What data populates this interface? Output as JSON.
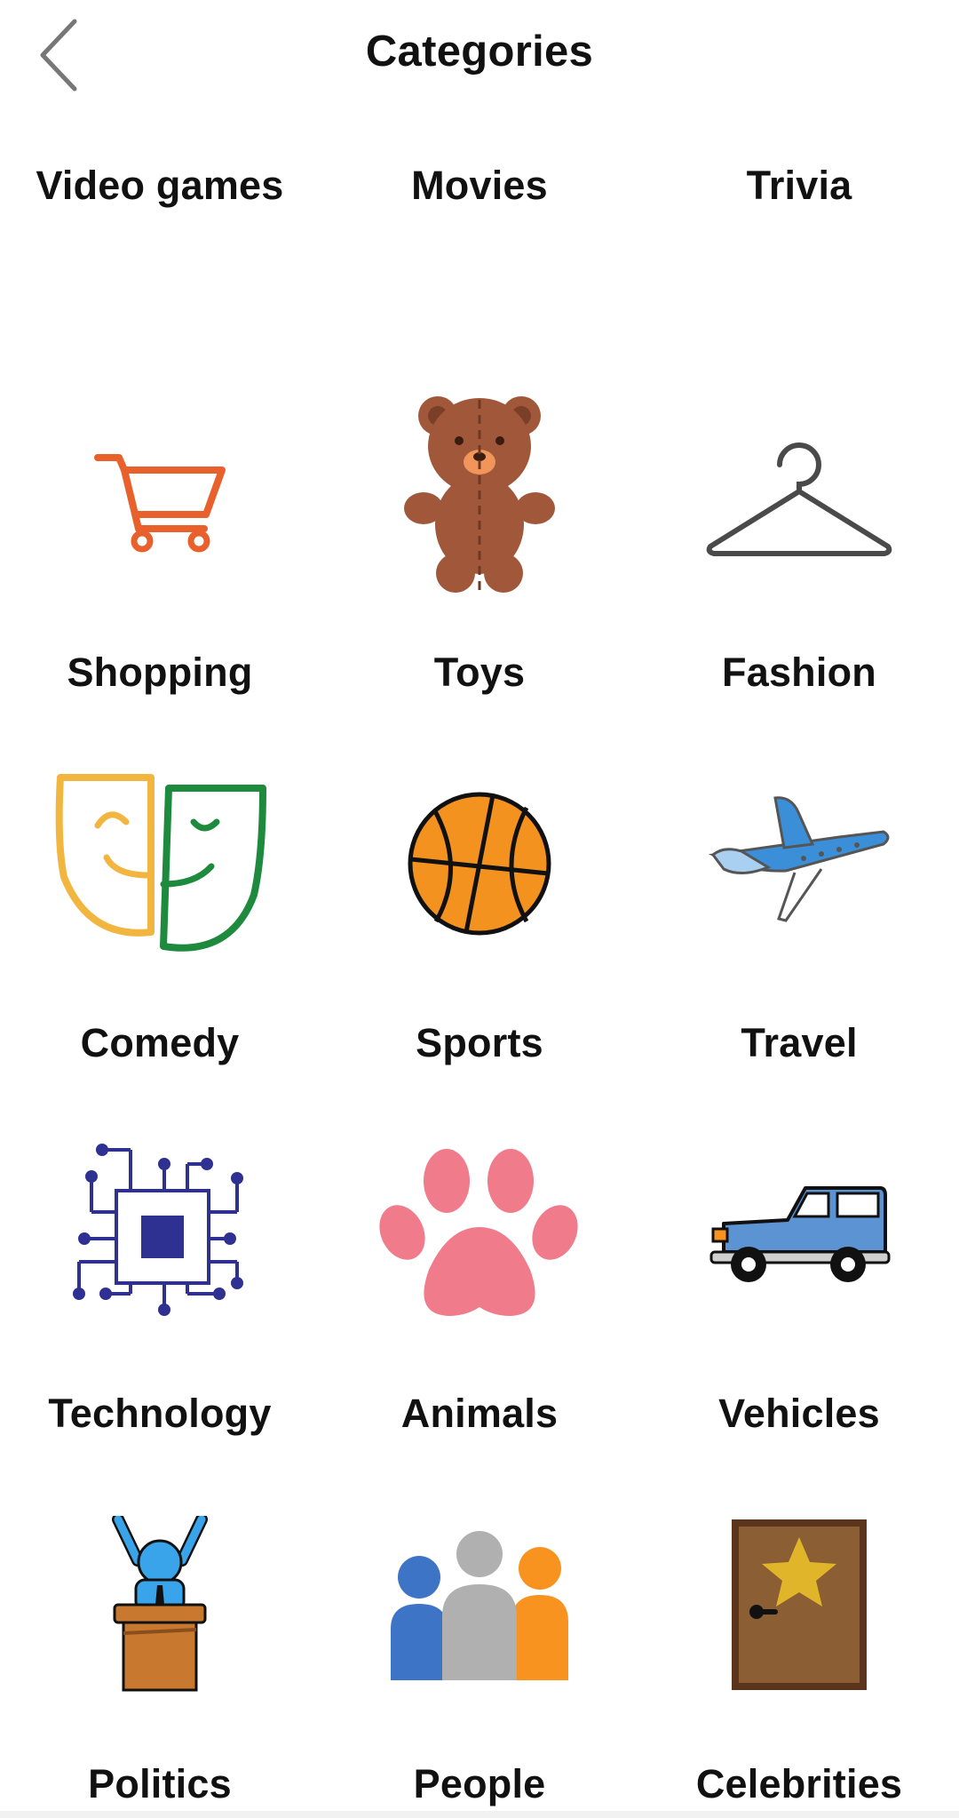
{
  "header": {
    "title": "Categories",
    "back_icon": "chevron-left-icon"
  },
  "categories": [
    {
      "label": "Video games",
      "icon": "gamepad-icon"
    },
    {
      "label": "Movies",
      "icon": "popcorn-icon"
    },
    {
      "label": "Trivia",
      "icon": "lightbulb-icon"
    },
    {
      "label": "Shopping",
      "icon": "shopping-cart-icon"
    },
    {
      "label": "Toys",
      "icon": "teddy-bear-icon"
    },
    {
      "label": "Fashion",
      "icon": "hanger-icon"
    },
    {
      "label": "Comedy",
      "icon": "comedy-masks-icon"
    },
    {
      "label": "Sports",
      "icon": "basketball-icon"
    },
    {
      "label": "Travel",
      "icon": "airplane-icon"
    },
    {
      "label": "Technology",
      "icon": "microchip-icon"
    },
    {
      "label": "Animals",
      "icon": "paw-icon"
    },
    {
      "label": "Vehicles",
      "icon": "car-icon"
    },
    {
      "label": "Politics",
      "icon": "podium-icon"
    },
    {
      "label": "People",
      "icon": "people-icon"
    },
    {
      "label": "Celebrities",
      "icon": "star-door-icon"
    }
  ],
  "colors": {
    "cart": "#e8602c",
    "bear": "#a0573a",
    "hanger": "#4a4a4a",
    "comedy_yellow": "#f2b640",
    "comedy_green": "#1e8a3d",
    "basketball": "#f3921f",
    "plane": "#3b8fd8",
    "chip": "#2e3192",
    "paw": "#f07b8b",
    "car": "#5b93d3",
    "politics_blue": "#3aa4ea",
    "podium": "#c9782f",
    "people_blue": "#3d74c6",
    "people_gray": "#b0b0b0",
    "people_orange": "#f7931e",
    "door": "#8b5e34",
    "star": "#e1b52a"
  }
}
